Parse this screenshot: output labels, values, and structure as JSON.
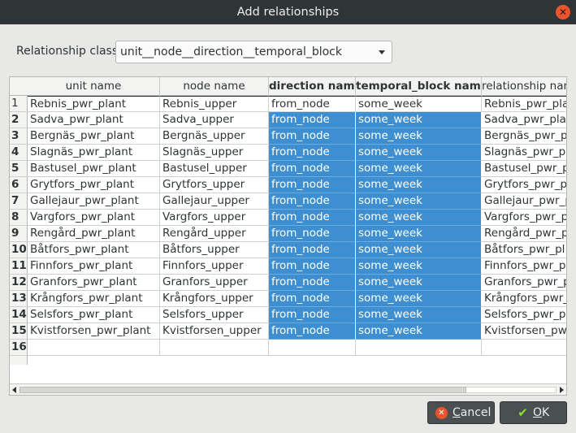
{
  "window": {
    "title": "Add relationships"
  },
  "relationship_class": {
    "label": "Relationship class",
    "selected": "unit__node__direction__temporal_block"
  },
  "table": {
    "headers": [
      "unit name",
      "node name",
      "direction name",
      "temporal_block name",
      "relationship name"
    ],
    "rows": [
      [
        "Rebnis_pwr_plant",
        "Rebnis_upper",
        "from_node",
        "some_week",
        "Rebnis_pwr_pla"
      ],
      [
        "Sadva_pwr_plant",
        "Sadva_upper",
        "from_node",
        "some_week",
        "Sadva_pwr_plant"
      ],
      [
        "Bergnäs_pwr_plant",
        "Bergnäs_upper",
        "from_node",
        "some_week",
        "Bergnäs_pwr_p"
      ],
      [
        "Slagnäs_pwr_plant",
        "Slagnäs_upper",
        "from_node",
        "some_week",
        "Slagnäs_pwr_p"
      ],
      [
        "Bastusel_pwr_plant",
        "Bastusel_upper",
        "from_node",
        "some_week",
        "Bastusel_pwr_p"
      ],
      [
        "Grytfors_pwr_plant",
        "Grytfors_upper",
        "from_node",
        "some_week",
        "Grytfors_pwr_p"
      ],
      [
        "Gallejaur_pwr_plant",
        "Gallejaur_upper",
        "from_node",
        "some_week",
        "Gallejaur_pwr_p"
      ],
      [
        "Vargfors_pwr_plant",
        "Vargfors_upper",
        "from_node",
        "some_week",
        "Vargfors_pwr_p"
      ],
      [
        "Rengård_pwr_plant",
        "Rengård_upper",
        "from_node",
        "some_week",
        "Rengård_pwr_p"
      ],
      [
        "Båtfors_pwr_plant",
        "Båtfors_upper",
        "from_node",
        "some_week",
        "Båtfors_pwr_pl"
      ],
      [
        "Finnfors_pwr_plant",
        "Finnfors_upper",
        "from_node",
        "some_week",
        "Finnfors_pwr_p"
      ],
      [
        "Granfors_pwr_plant",
        "Granfors_upper",
        "from_node",
        "some_week",
        "Granfors_pwr_p"
      ],
      [
        "Krångfors_pwr_plant",
        "Krångfors_upper",
        "from_node",
        "some_week",
        "Krångfors_pwr_"
      ],
      [
        "Selsfors_pwr_plant",
        "Selsfors_upper",
        "from_node",
        "some_week",
        "Selsfors_pwr_p"
      ],
      [
        "Kvistforsen_pwr_plant",
        "Kvistforsen_upper",
        "from_node",
        "some_week",
        "Kvistforsen_pw"
      ],
      [
        "",
        "",
        "",
        "",
        ""
      ]
    ],
    "row_numbers": [
      "1",
      "2",
      "3",
      "4",
      "5",
      "6",
      "7",
      "8",
      "9",
      "10",
      "11",
      "12",
      "13",
      "14",
      "15",
      "16"
    ]
  },
  "buttons": {
    "cancel": {
      "label_underlined": "C",
      "label_rest": "ancel"
    },
    "ok": {
      "label_underlined": "O",
      "label_rest": "K"
    }
  },
  "colors": {
    "titlebar": "#2f3436",
    "selection": "#3d8fd1",
    "close": "#e9542f"
  }
}
